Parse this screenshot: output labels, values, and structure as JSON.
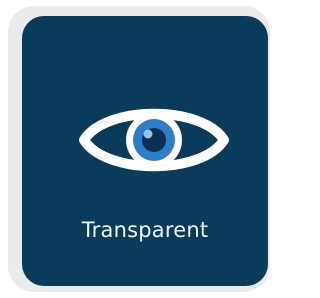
{
  "card": {
    "label": "Transparent",
    "icon": "eye-icon",
    "colors": {
      "tile_background": "#0b3b5b",
      "frame_background": "#e9ebed",
      "eye_outline": "#ffffff",
      "iris": "#2b7fc8",
      "pupil": "#0a3152"
    }
  }
}
